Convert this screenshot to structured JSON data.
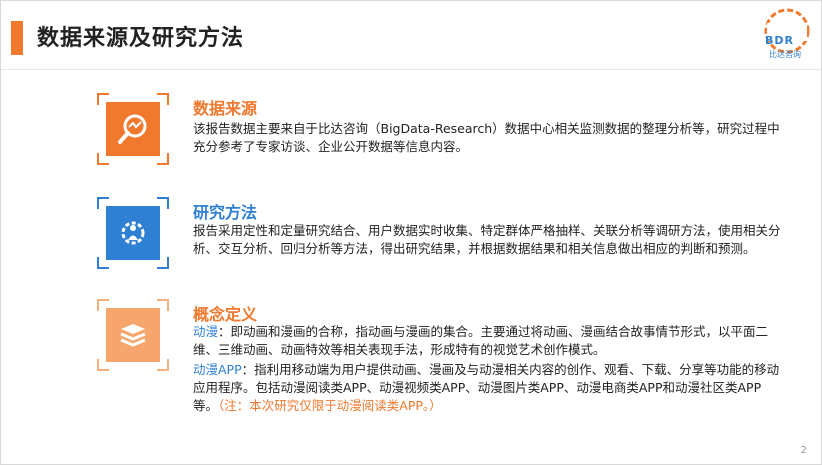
{
  "header": {
    "title": "数据来源及研究方法",
    "logo_text": "BDR",
    "logo_sub": "比达咨询"
  },
  "sections": [
    {
      "title": "数据来源",
      "body": "该报告数据主要来自于比达咨询（BigData-Research）数据中心相关监测数据的整理分析等，研究过程中充分参考了专家访谈、企业公开数据等信息内容。",
      "icon": "magnifier-chart-icon"
    },
    {
      "title": "研究方法",
      "body": "报告采用定性和定量研究结合、用户数据实时收集、特定群体严格抽样、关联分析等调研方法，使用相关分析、交互分析、回归分析等方法，得出研究结果，并根据数据结果和相关信息做出相应的判断和预测。",
      "icon": "gear-person-icon"
    },
    {
      "title": "概念定义",
      "icon": "layers-icon",
      "term1": "动漫",
      "def1": "：即动画和漫画的合称，指动画与漫画的集合。主要通过将动画、漫画结合故事情节形式，以平面二维、三维动画、动画特效等相关表现手法，形成特有的视觉艺术创作模式。",
      "term2": "动漫APP",
      "def2": "：指利用移动端为用户提供动画、漫画及与动漫相关内容的创作、观看、下载、分享等功能的移动应用程序。包括动漫阅读类APP、动漫视频类APP、动漫图片类APP、动漫电商类APP和动漫社区类APP等。",
      "note": "（注：本次研究仅限于动漫阅读类APP。）"
    }
  ],
  "page_number": "2",
  "colors": {
    "accent": "#f0792e",
    "blue": "#2f7fd3"
  }
}
